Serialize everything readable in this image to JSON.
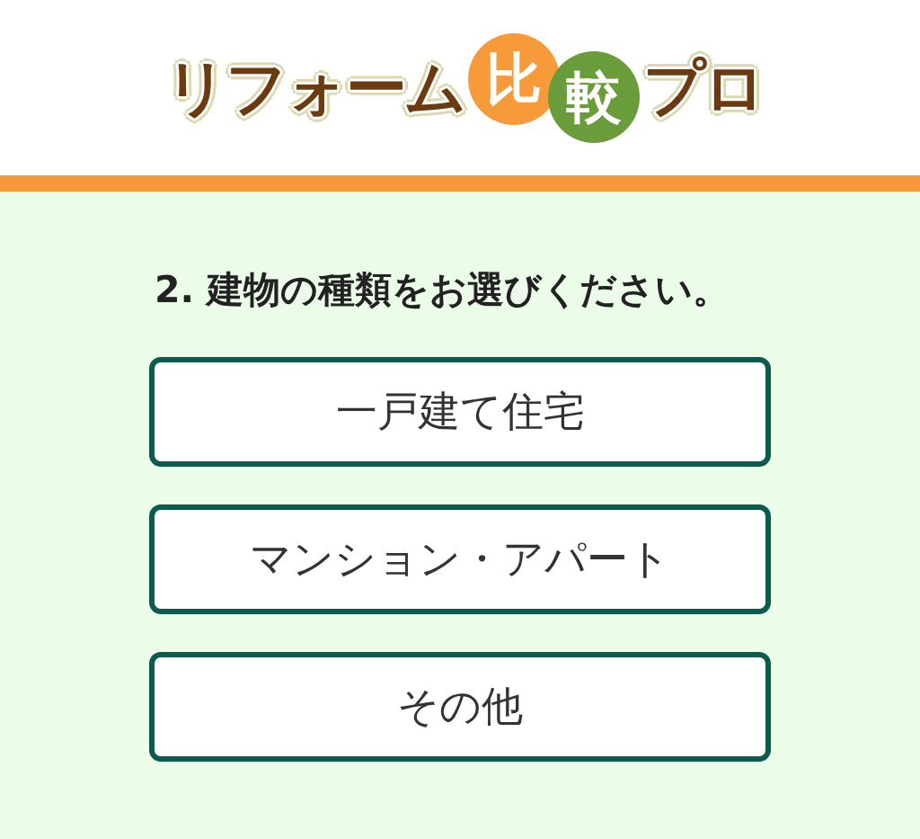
{
  "logo": {
    "parts": [
      {
        "text": "リフォーム",
        "kind": "plain"
      },
      {
        "text": "比",
        "kind": "circle",
        "color": "#f79a3a"
      },
      {
        "text": "較",
        "kind": "circle",
        "color": "#6a9c3c"
      },
      {
        "text": "プロ",
        "kind": "plain"
      }
    ]
  },
  "question": {
    "text": "2. 建物の種類をお選びください。"
  },
  "options": [
    {
      "label": "一戸建て住宅"
    },
    {
      "label": "マンション・アパート"
    },
    {
      "label": "その他"
    }
  ]
}
